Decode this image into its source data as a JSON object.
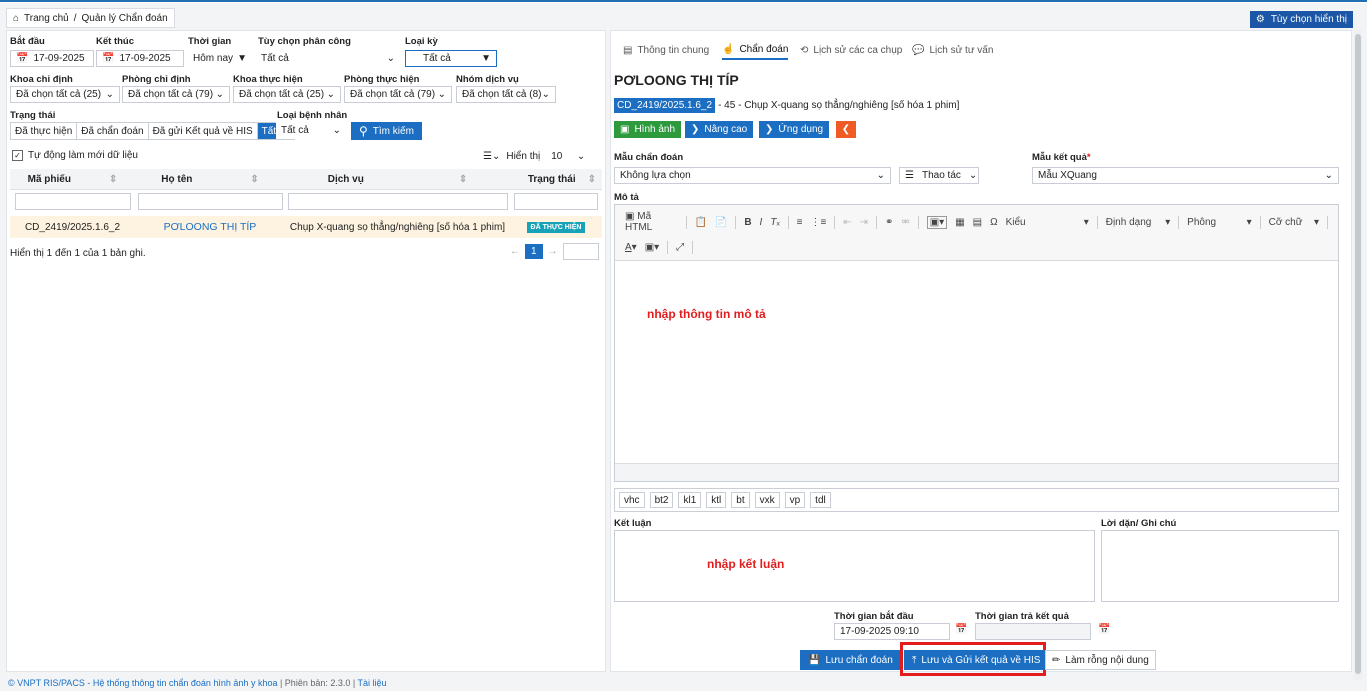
{
  "breadcrumb": {
    "home": "Trang chủ",
    "sep": "/",
    "current": "Quản lý Chẩn đoán"
  },
  "options_button": "Tùy chọn hiển thị",
  "filters": {
    "start_label": "Bắt đầu",
    "start_value": "17-09-2025",
    "end_label": "Kết thúc",
    "end_value": "17-09-2025",
    "time_label": "Thời gian",
    "time_value": "Hôm nay",
    "assign_label": "Tùy chọn phân công",
    "assign_value": "Tất cả",
    "period_label": "Loại kỳ",
    "period_value": "Tất cả",
    "dept_order_label": "Khoa chỉ định",
    "dept_order_value": "Đã chọn tất cả (25)",
    "room_order_label": "Phòng chỉ định",
    "room_order_value": "Đã chọn tất cả (79)",
    "dept_exec_label": "Khoa thực hiện",
    "dept_exec_value": "Đã chọn tất cả (25)",
    "room_exec_label": "Phòng thực hiện",
    "room_exec_value": "Đã chọn tất cả (79)",
    "group_label": "Nhóm dịch vụ",
    "group_value": "Đã chọn tất cả (8)",
    "status_label": "Trạng thái",
    "status_options": [
      "Đã thực hiện",
      "Đã chẩn đoán",
      "Đã gửi Kết quả về HIS",
      "Tất cả"
    ],
    "patient_type_label": "Loại bệnh nhân",
    "patient_type_value": "Tất cả",
    "search_button": "Tìm kiếm"
  },
  "auto_refresh": "Tự động làm mới dữ liệu",
  "page_size_label": "Hiển thị",
  "page_size_value": "10",
  "table": {
    "headers": [
      "Mã phiếu",
      "Họ tên",
      "Dịch vụ",
      "Trạng thái"
    ],
    "rows": [
      {
        "code": "CD_2419/2025.1.6_2",
        "name": "PƠLOONG THỊ TÍP",
        "service": "Chụp X-quang sọ thẳng/nghiêng [số hóa 1 phim]",
        "status": "ĐÃ THỰC HIỆN"
      }
    ]
  },
  "pagination": {
    "summary": "Hiển thị 1 đến 1 của 1 bản ghi.",
    "current": "1",
    "prev": "←",
    "next": "→"
  },
  "right_tabs": [
    "Thông tin chung",
    "Chẩn đoán",
    "Lịch sử các ca chụp",
    "Lịch sử tư vấn"
  ],
  "patient_name": "PƠLOONG THỊ TÍP",
  "order_code": "CD_2419/2025.1.6_2",
  "order_desc": "- 45 - Chụp X-quang sọ thẳng/nghiêng [số hóa 1 phim]",
  "tool_buttons": {
    "image": "Hình ảnh",
    "advanced": "Nâng cao",
    "app": "Ứng dụng"
  },
  "diag_template_label": "Mẫu chẩn đoán",
  "diag_template_value": "Không lựa chọn",
  "action_label": "Thao tác",
  "result_template_label": "Mẫu kết quả",
  "required_mark": "*",
  "result_template_value": "Mẫu XQuang",
  "desc_label": "Mô tả",
  "editor": {
    "html": "Mã HTML",
    "style": "Kiểu",
    "format": "Định dạng",
    "font": "Phông",
    "size": "Cỡ chữ"
  },
  "desc_placeholder": "nhập thông tin mô tả",
  "abbreviations": [
    "vhc",
    "bt2",
    "kl1",
    "ktl",
    "bt",
    "vxk",
    "vp",
    "tdl"
  ],
  "conclusion_label": "Kết luận",
  "conclusion_placeholder": "nhập kết luận",
  "note_label": "Lời dặn/ Ghi chú",
  "start_time_label": "Thời gian bắt đầu",
  "start_time_value": "17-09-2025 09:10",
  "return_time_label": "Thời gian trả kết quả",
  "save_button": "Lưu chẩn đoán",
  "save_send_button": "Lưu và Gửi kết quả về HIS",
  "clear_button": "Làm rỗng nội dung",
  "footer": {
    "product": "© VNPT RIS/PACS - Hệ thống thông tin chẩn đoán hình ảnh y khoa",
    "version": " | Phiên bản: 2.3.0 | ",
    "docs": "Tài liệu"
  },
  "colors": {
    "primary": "#1b6ec2",
    "green": "#2e9a3e",
    "orange": "#f05a24",
    "highlight": "#e11d1d",
    "row": "#fdf3e0"
  }
}
